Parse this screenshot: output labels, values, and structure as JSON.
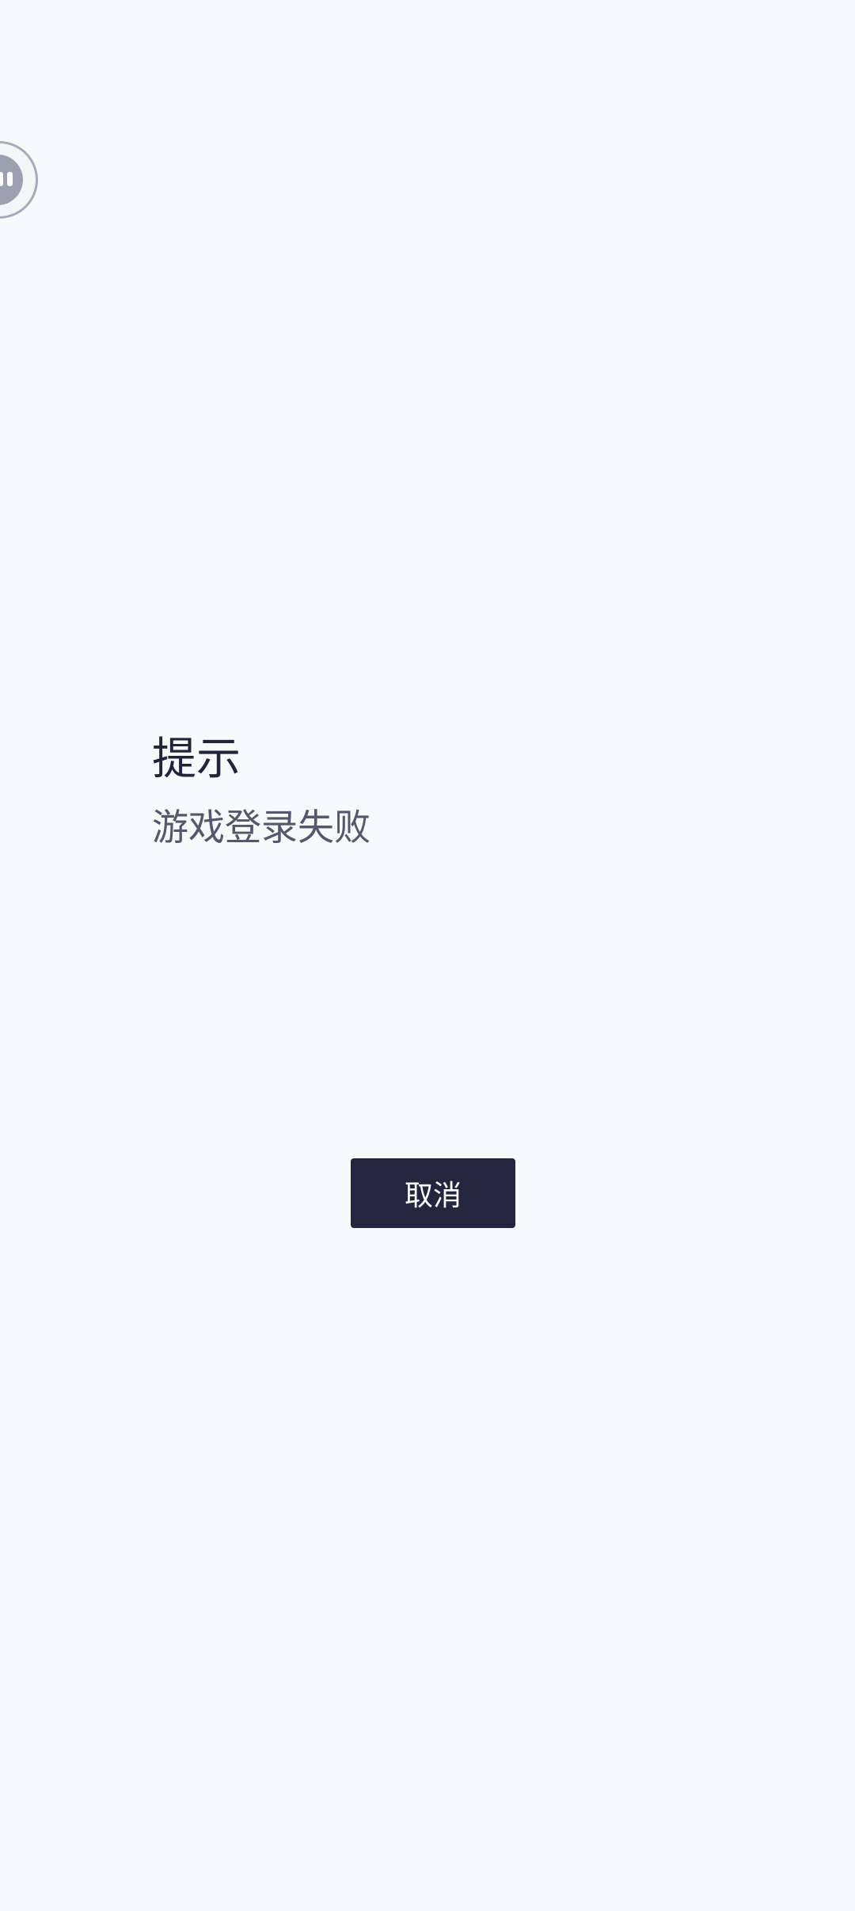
{
  "floating_ball": {
    "icon": "assistant-face-icon"
  },
  "dialog": {
    "title": "提示",
    "message": "游戏登录失败",
    "cancel_label": "取消"
  },
  "colors": {
    "background": "#f8f9fb",
    "button_bg": "#242640",
    "title_text": "#22243a",
    "message_text": "#55586a"
  }
}
